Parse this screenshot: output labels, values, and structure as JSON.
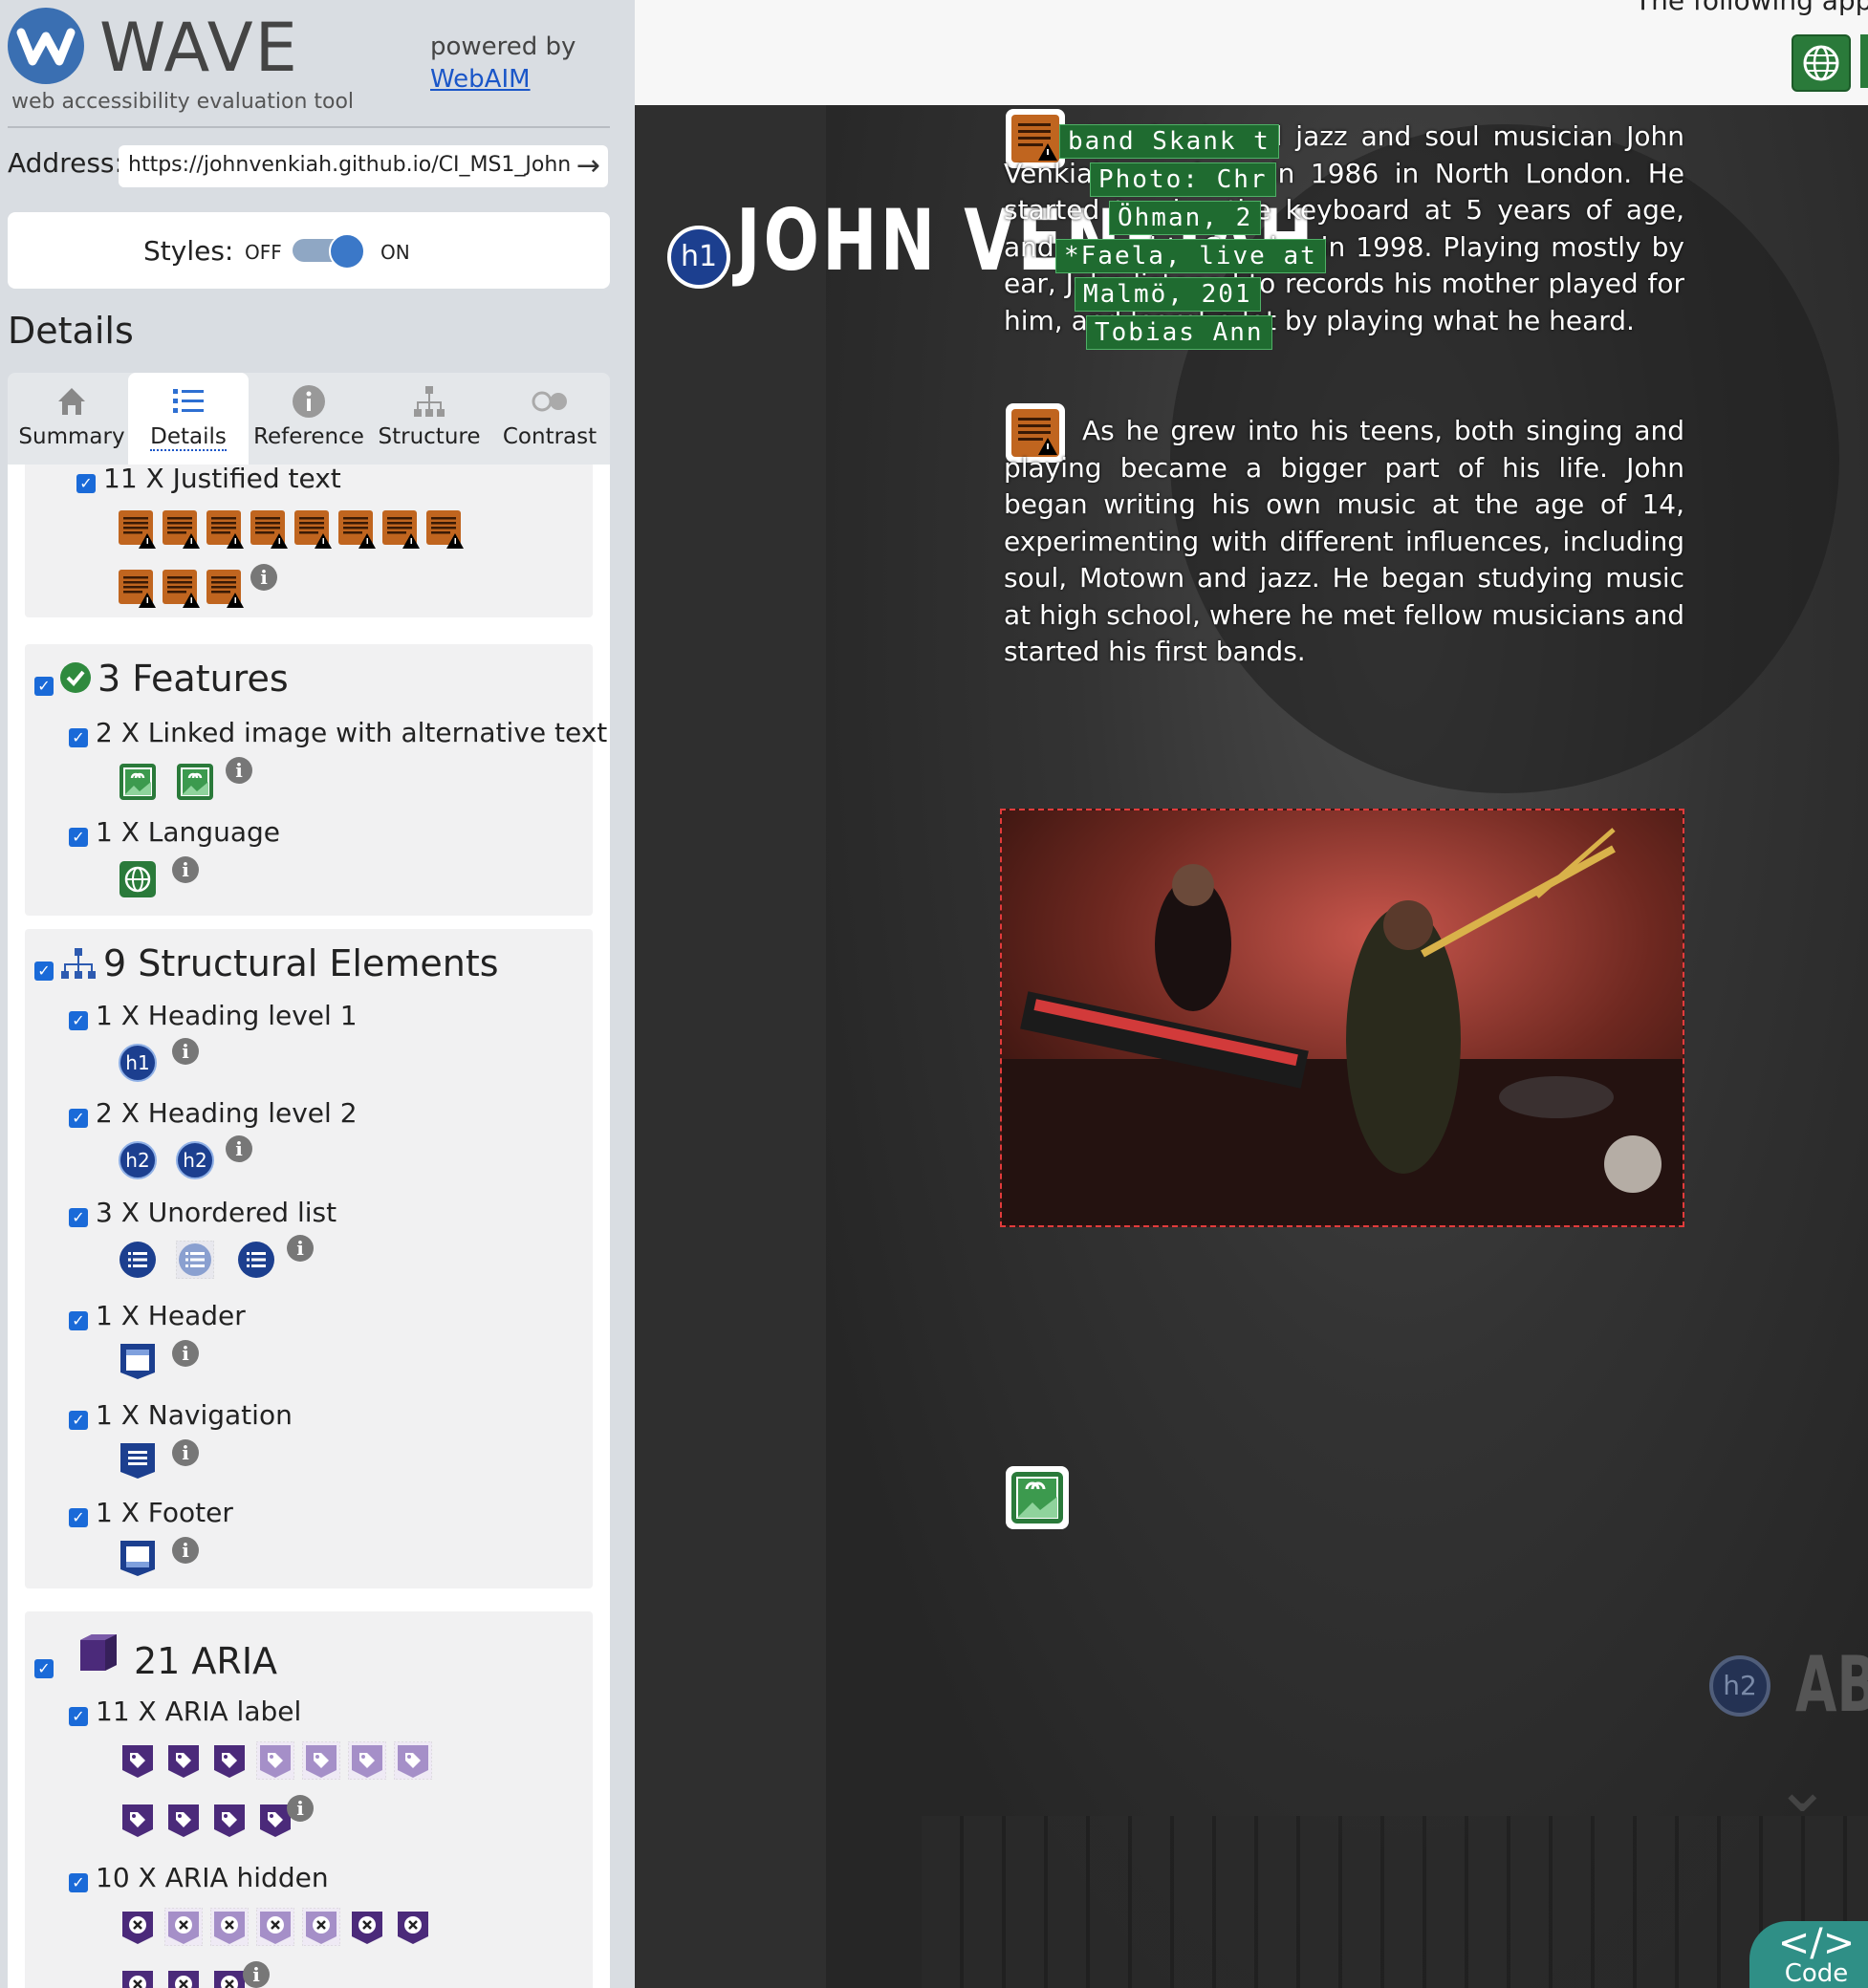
{
  "app": {
    "logo_text": "WAVE",
    "tagline": "web accessibility evaluation tool",
    "powered_by": "powered by",
    "powered_link": "WebAIM"
  },
  "address": {
    "label": "Address:",
    "value": "https://johnvenkiah.github.io/CI_MS1_John"
  },
  "styles": {
    "label": "Styles:",
    "off": "OFF",
    "on": "ON",
    "state": "on"
  },
  "details_heading": "Details",
  "tabs": [
    {
      "label": "Summary",
      "icon": "home-icon"
    },
    {
      "label": "Details",
      "icon": "list-icon",
      "active": true
    },
    {
      "label": "Reference",
      "icon": "info-icon"
    },
    {
      "label": "Structure",
      "icon": "structure-icon"
    },
    {
      "label": "Contrast",
      "icon": "contrast-icon"
    }
  ],
  "groups": {
    "justified": {
      "label": "11 X Justified text",
      "count": 11
    },
    "features": {
      "heading": "3 Features",
      "items": [
        {
          "label": "2 X Linked image with alternative text"
        },
        {
          "label": "1 X Language"
        }
      ]
    },
    "structural": {
      "heading": "9 Structural Elements",
      "items": [
        {
          "label": "1 X Heading level 1",
          "badge": "h1"
        },
        {
          "label": "2 X Heading level 2",
          "badge": "h2"
        },
        {
          "label": "3 X Unordered list"
        },
        {
          "label": "1 X Header"
        },
        {
          "label": "1 X Navigation"
        },
        {
          "label": "1 X Footer"
        }
      ]
    },
    "aria": {
      "heading": "21 ARIA",
      "items": [
        {
          "label": "11 X ARIA label"
        },
        {
          "label": "10 X ARIA hidden"
        }
      ]
    }
  },
  "page": {
    "top_text": "The following apply t",
    "title": "JOHN VENKIAH",
    "h1_badge": "h1",
    "h2_badge": "h2",
    "section_fragment": "AB",
    "para1": "Sweden-based jazz and soul musician John Venkiah was born in 1986 in North London. He started to play the keyboard at 5 years of age, and moved to Sweden in 1998. Playing mostly by ear, John listened to records his mother played for him, and learnt a lot by playing what he heard.",
    "para2": "As he grew into his teens, both singing and playing became a bigger part of his life. John began writing his own music at the age of 14, experimenting with different influences, including soul, Motown and jazz. He began studying music at high school, where he met fellow musicians and started his first bands.",
    "captions": [
      "band Skank t",
      "Photo: Chr",
      "Öhman, 2",
      "*Faela, live at",
      "Malmö, 201",
      "Tobias Ann"
    ],
    "code_button": "</>",
    "code_label": "Code"
  },
  "colors": {
    "sidebar_bg": "#d9dde2",
    "justified_icon": "#c0651f",
    "feature_icon": "#2a7a3a",
    "structure_icon": "#1c3f8f",
    "aria_icon": "#4b2a7a"
  }
}
